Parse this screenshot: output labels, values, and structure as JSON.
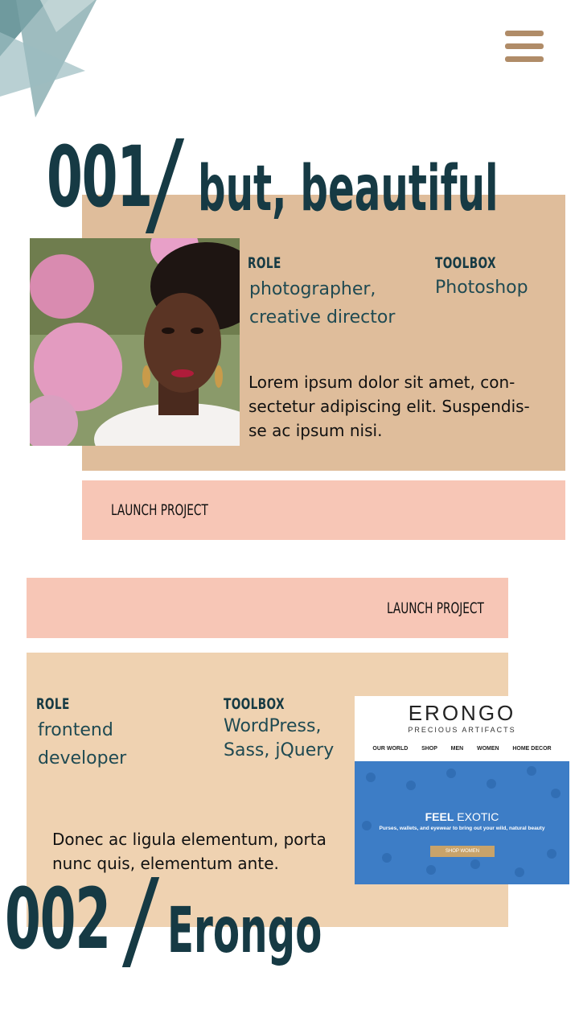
{
  "header": {
    "menu_icon": "hamburger-menu-icon",
    "logo_icon": "geometric-triangles-logo-icon"
  },
  "projects": [
    {
      "number": "001",
      "slash": "/",
      "title": "but, beautiful",
      "role_label": "ROLE",
      "role_lines": [
        "photographer,",
        "creative director"
      ],
      "toolbox_label": "TOOLBOX",
      "toolbox_lines": [
        "Photoshop"
      ],
      "description_lines": [
        "Lorem ipsum dolor sit amet, con-",
        "sectetur adipiscing elit. Suspendis-",
        "se ac ipsum nisi."
      ],
      "launch_label": "LAUNCH PROJECT"
    },
    {
      "number": "002",
      "slash": "/",
      "title": "Erongo",
      "role_label": "ROLE",
      "role_lines": [
        "frontend",
        "developer"
      ],
      "toolbox_label": "TOOLBOX",
      "toolbox_lines": [
        "WordPress,",
        "Sass, jQuery"
      ],
      "description_lines": [
        "Donec ac ligula elementum, porta",
        "nunc quis, elementum ante."
      ],
      "launch_label": "LAUNCH PROJECT",
      "screenshot": {
        "brand": "ERONGO",
        "tagline": "PRECIOUS ARTIFACTS",
        "nav": [
          "OUR WORLD",
          "SHOP",
          "MEN",
          "WOMEN",
          "HOME DECOR"
        ],
        "hero_title_bold": "FEEL",
        "hero_title_rest": " EXOTIC",
        "hero_text": "Purses, wallets, and eyewear to bring out your wild, natural beauty",
        "hero_button": "SHOP WOMEN"
      }
    }
  ],
  "colors": {
    "accent_dark": "#163a44",
    "card_tan": "#dfbd9b",
    "card_sand": "#efd2b1",
    "launch_pink": "#f7c6b6",
    "menu_brown": "#b08c68"
  }
}
